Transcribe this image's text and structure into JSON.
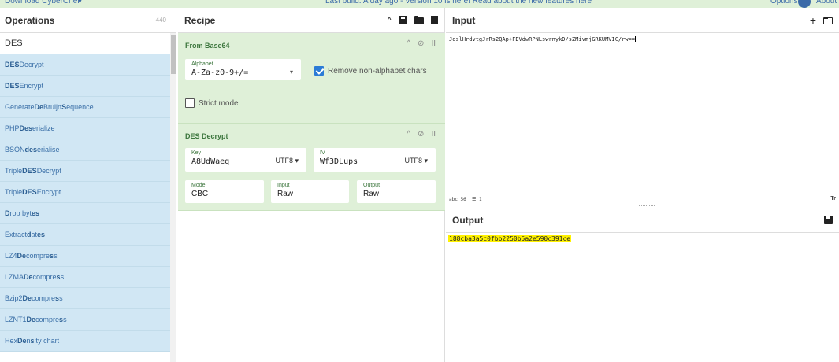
{
  "banner": {
    "download_label": "Download CyberChef",
    "message": "Last build: A day ago - Version 10 is here! Read about the new features here",
    "options_label": "Options",
    "about_label": "About"
  },
  "operations": {
    "title": "Operations",
    "count": "440",
    "search_value": "DES",
    "items": [
      {
        "pre": "",
        "bold": "DES",
        "post": " Decrypt"
      },
      {
        "pre": "",
        "bold": "DES",
        "post": " Encrypt"
      },
      {
        "pre": "Generate ",
        "bold": "De",
        "post": " Bruijn ",
        "bold2": "S",
        "post2": "equence"
      },
      {
        "pre": "PHP ",
        "bold": "Des",
        "post": "erialize"
      },
      {
        "pre": "BSON ",
        "bold": "des",
        "post": "erialise"
      },
      {
        "pre": "Triple ",
        "bold": "DES",
        "post": " Decrypt"
      },
      {
        "pre": "Triple ",
        "bold": "DES",
        "post": " Encrypt"
      },
      {
        "pre": "",
        "bold": "D",
        "post": "rop byt",
        "bold2": "es",
        "post2": ""
      },
      {
        "pre": "Extract ",
        "bold": "d",
        "post": "at",
        "bold2": "es",
        "post2": ""
      },
      {
        "pre": "LZ4 ",
        "bold": "De",
        "post": "compre",
        "bold2": "s",
        "post2": "s"
      },
      {
        "pre": "LZMA ",
        "bold": "De",
        "post": "compre",
        "bold2": "s",
        "post2": "s"
      },
      {
        "pre": "Bzip2 ",
        "bold": "De",
        "post": "compre",
        "bold2": "s",
        "post2": "s"
      },
      {
        "pre": "LZNT1 ",
        "bold": "De",
        "post": "compre",
        "bold2": "s",
        "post2": "s"
      },
      {
        "pre": "Hex ",
        "bold": "De",
        "post": "n",
        "bold2": "s",
        "post2": "ity chart"
      }
    ]
  },
  "recipe": {
    "title": "Recipe",
    "from_base64": {
      "name": "From Base64",
      "alphabet_label": "Alphabet",
      "alphabet_value": "A-Za-z0-9+/=",
      "remove_label": "Remove non-alphabet chars",
      "strict_label": "Strict mode"
    },
    "des_decrypt": {
      "name": "DES Decrypt",
      "key_label": "Key",
      "key_value": "A8UdWaeq",
      "key_encoding": "UTF8",
      "iv_label": "IV",
      "iv_value": "Wf3DLups",
      "iv_encoding": "UTF8",
      "mode_label": "Mode",
      "mode_value": "CBC",
      "input_label": "Input",
      "input_value": "Raw",
      "output_label": "Output",
      "output_value": "Raw"
    }
  },
  "input": {
    "title": "Input",
    "value": "JqslHrdvtgJrRs2QAp+FEVdwRPNLswrnykD/sZMivmjGRKUMVIC/rw==",
    "status_chars": "56",
    "status_lines": "1"
  },
  "output": {
    "title": "Output",
    "value": "188cba3a5c0fbb2250b5a2e590c391ce"
  },
  "colors": {
    "recipe_bg": "#dff0d8",
    "ops_item_bg": "#d1e7f4",
    "output_highlight": "#fff200",
    "checkbox_accent": "#2b7bd6"
  }
}
